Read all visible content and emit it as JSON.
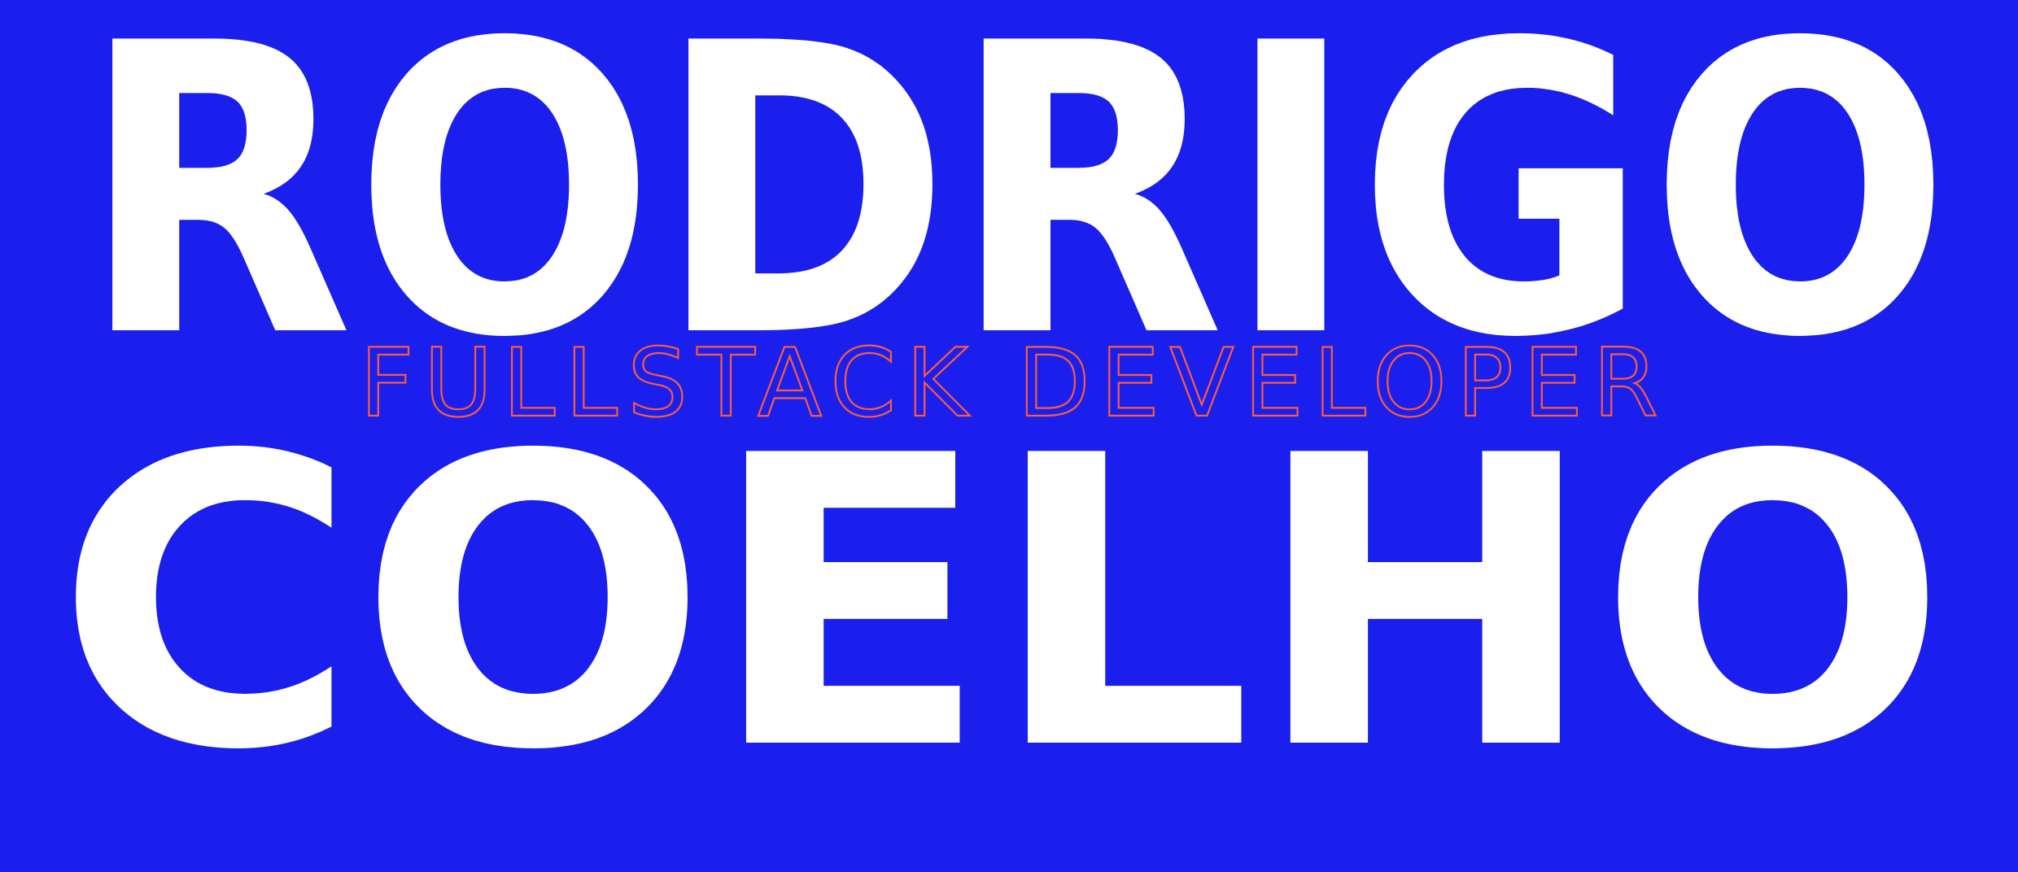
{
  "hero": {
    "first_name": "RODRIGO",
    "role": "FULLSTACK DEVELOPER",
    "last_name": "COELHO"
  },
  "colors": {
    "background": "#1a1fee",
    "name_text": "#ffffff",
    "role_outline": "#ff5a3c"
  }
}
